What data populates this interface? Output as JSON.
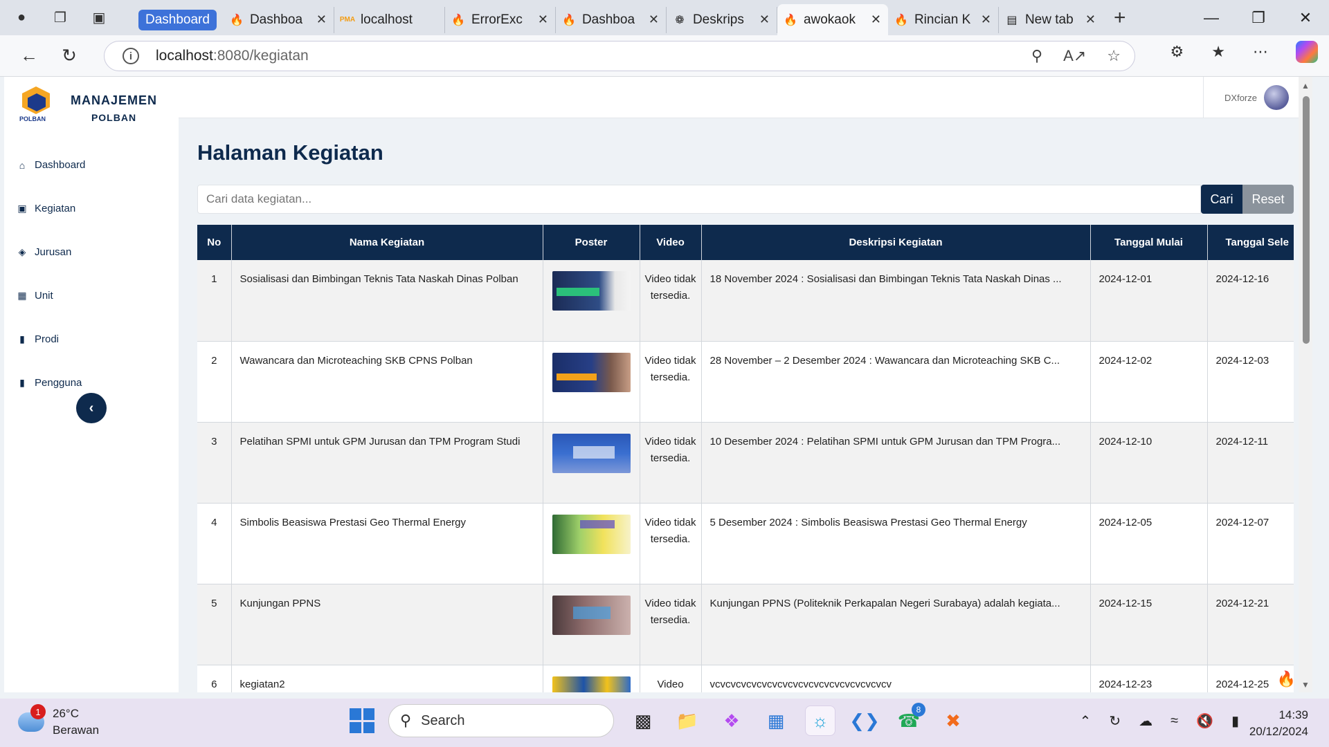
{
  "browser": {
    "tab_group_label": "Dashboard",
    "tabs": [
      {
        "title": "Dashboa",
        "favicon": "flame-icon",
        "active": false
      },
      {
        "title": "localhost",
        "favicon": "pma-icon",
        "active": false
      },
      {
        "title": "ErrorExc",
        "favicon": "flame-icon",
        "active": false
      },
      {
        "title": "Dashboa",
        "favicon": "flame-icon",
        "active": false
      },
      {
        "title": "Deskrips",
        "favicon": "openai-icon",
        "active": false
      },
      {
        "title": "awokaok",
        "favicon": "flame-icon",
        "active": true
      },
      {
        "title": "Rincian K",
        "favicon": "flame-icon",
        "active": false
      },
      {
        "title": "New tab",
        "favicon": "newtab-icon",
        "active": false
      }
    ],
    "url_host": "localhost",
    "url_path": ":8080/kegiatan"
  },
  "sidebar": {
    "brand_title": "MANAJEMEN",
    "brand_subtitle": "POLBAN",
    "logo_text": "POLBAN",
    "items": [
      {
        "label": "Dashboard",
        "icon": "home-icon"
      },
      {
        "label": "Kegiatan",
        "icon": "calendar-icon"
      },
      {
        "label": "Jurusan",
        "icon": "graduation-cap-icon"
      },
      {
        "label": "Unit",
        "icon": "chart-icon"
      },
      {
        "label": "Prodi",
        "icon": "bookmark-icon"
      },
      {
        "label": "Pengguna",
        "icon": "bookmark-icon"
      }
    ],
    "collapse_glyph": "‹"
  },
  "topbar": {
    "username": "DXforze"
  },
  "main": {
    "page_title": "Halaman Kegiatan",
    "search": {
      "placeholder": "Cari data kegiatan...",
      "submit_label": "Cari",
      "reset_label": "Reset"
    },
    "table": {
      "headers": [
        "No",
        "Nama Kegiatan",
        "Poster",
        "Video",
        "Deskripsi Kegiatan",
        "Tanggal Mulai",
        "Tanggal Sele"
      ],
      "rows": [
        {
          "no": "1",
          "name": "Sosialisasi dan Bimbingan Teknis Tata Naskah Dinas Polban",
          "video": "Video tidak tersedia.",
          "desc": "18 November 2024 : Sosialisasi dan Bimbingan Teknis Tata Naskah Dinas ...",
          "start": "2024-12-01",
          "end": "2024-12-16"
        },
        {
          "no": "2",
          "name": "Wawancara dan Microteaching SKB CPNS Polban",
          "video": "Video tidak tersedia.",
          "desc": "28 November – 2 Desember 2024 : Wawancara dan Microteaching SKB C...",
          "start": "2024-12-02",
          "end": "2024-12-03"
        },
        {
          "no": "3",
          "name": "Pelatihan SPMI untuk GPM Jurusan dan TPM Program Studi",
          "video": "Video tidak tersedia.",
          "desc": "10 Desember 2024 : Pelatihan SPMI untuk GPM Jurusan dan TPM Progra...",
          "start": "2024-12-10",
          "end": "2024-12-11"
        },
        {
          "no": "4",
          "name": "Simbolis Beasiswa Prestasi Geo Thermal Energy",
          "video": "Video tidak tersedia.",
          "desc": "5 Desember 2024 : Simbolis Beasiswa Prestasi Geo Thermal Energy",
          "start": "2024-12-05",
          "end": "2024-12-07"
        },
        {
          "no": "5",
          "name": "Kunjungan PPNS",
          "video": "Video tidak tersedia.",
          "desc": "Kunjungan PPNS (Politeknik Perkapalan Negeri Surabaya) adalah kegiata...",
          "start": "2024-12-15",
          "end": "2024-12-21"
        },
        {
          "no": "6",
          "name": "kegiatan2",
          "video": "Video",
          "desc": "vcvcvcvcvcvcvcvcvcvcvcvcvcvcvcvcvcv",
          "start": "2024-12-23",
          "end": "2024-12-25"
        }
      ]
    }
  },
  "taskbar": {
    "weather_temp": "26°C",
    "weather_desc": "Berawan",
    "weather_badge": "1",
    "search_label": "Search",
    "whatsapp_badge": "8",
    "time": "14:39",
    "date": "20/12/2024"
  }
}
